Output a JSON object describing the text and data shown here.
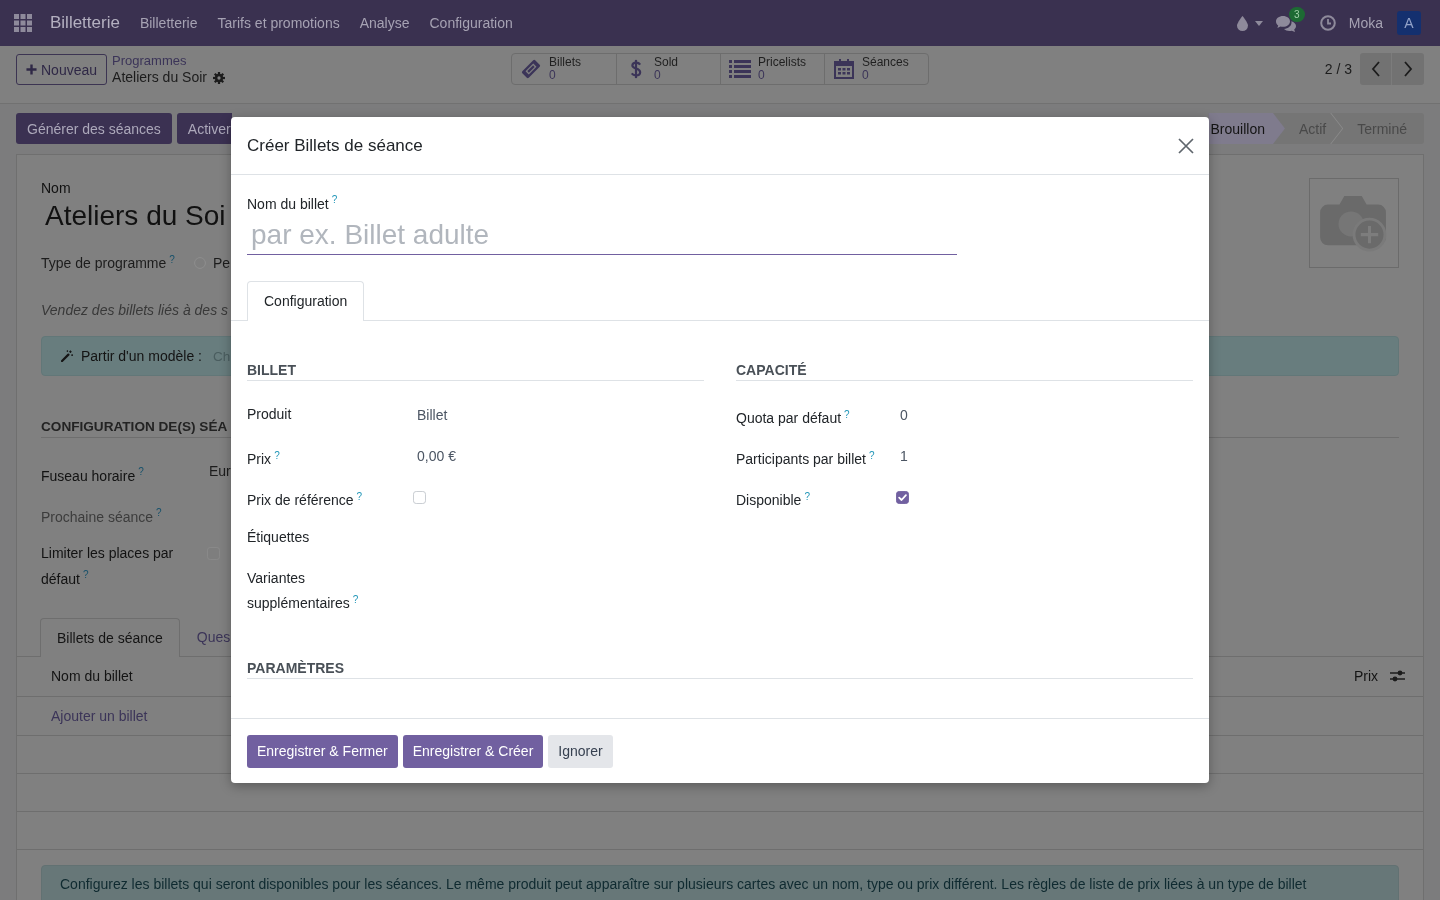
{
  "navbar": {
    "brand": "Billetterie",
    "menu": [
      {
        "label": "Billetterie"
      },
      {
        "label": "Tarifs et promotions"
      },
      {
        "label": "Analyse"
      },
      {
        "label": "Configuration"
      }
    ],
    "systray": {
      "chat_count": "3",
      "user": "Moka",
      "avatar": "A"
    }
  },
  "control_panel": {
    "new_button": "Nouveau",
    "breadcrumb": {
      "parent": "Programmes",
      "current": "Ateliers du Soir"
    },
    "stat_buttons": [
      {
        "kind": "ticket",
        "label": "Billets",
        "value": "0"
      },
      {
        "kind": "dollar",
        "label": "Sold",
        "value": "0"
      },
      {
        "kind": "list",
        "label": "Pricelists",
        "value": "0"
      },
      {
        "kind": "calendar",
        "label": "Séances",
        "value": "0"
      }
    ],
    "pager": "2 / 3"
  },
  "action_buttons": [
    {
      "label": "Générer des séances"
    },
    {
      "label": "Activer"
    }
  ],
  "status_stages": [
    {
      "label": "Brouillon",
      "selected": true
    },
    {
      "label": "Actif",
      "selected": false
    },
    {
      "label": "Terminé",
      "selected": false
    }
  ],
  "form": {
    "name_label": "Nom",
    "name": "Ateliers du Soi",
    "program_type": {
      "label": "Type de programme",
      "help": "?",
      "options": [
        {
          "label": "Pe",
          "selected": false
        }
      ]
    },
    "description": "Vendez des billets liés à des s",
    "template_banner": {
      "label": "Partir d'un modèle :",
      "placeholder": "Ch"
    },
    "section": "CONFIGURATION DE(S) SÉA",
    "fields": [
      {
        "kind": "select",
        "label": "Fuseau horaire",
        "help": "?",
        "value": "Eur"
      },
      {
        "kind": "readonly",
        "label": "Prochaine séance",
        "help": "?"
      },
      {
        "kind": "checkbox",
        "label": "Limiter les places par défaut",
        "help": "?",
        "checked": false
      }
    ],
    "tabs": [
      {
        "label": "Billets de séance",
        "selected": true
      },
      {
        "label": "Ques",
        "selected": false
      }
    ],
    "table": {
      "columns": [
        {
          "label": "Nom du billet"
        },
        {
          "label": "Prix"
        }
      ],
      "add_line": "Ajouter un billet"
    },
    "info": "Configurez les billets qui seront disponibles pour les séances. Le même produit peut apparaître sur plusieurs cartes avec un nom, type ou prix différent. Les règles de liste de prix liées à un type de billet"
  },
  "dialog": {
    "title": "Créer Billets de séance",
    "name_field": {
      "label": "Nom du billet",
      "help": "?",
      "placeholder": "par ex. Billet adulte"
    },
    "tabs": [
      {
        "label": "Configuration",
        "selected": true
      }
    ],
    "groups": [
      {
        "title": "BILLET",
        "fields": [
          {
            "kind": "text",
            "label": "Produit",
            "value": "Billet"
          },
          {
            "kind": "text",
            "label": "Prix",
            "help": "?",
            "value": "0,00 €"
          },
          {
            "kind": "checkbox",
            "label": "Prix de référence",
            "help": "?",
            "checked": false
          },
          {
            "kind": "text",
            "label": "Étiquettes"
          },
          {
            "kind": "text",
            "label": "Variantes supplémentaires",
            "help": "?"
          }
        ]
      },
      {
        "title": "CAPACITÉ",
        "fields": [
          {
            "kind": "text",
            "label": "Quota par défaut",
            "help": "?",
            "value": "0"
          },
          {
            "kind": "text",
            "label": "Participants par billet",
            "help": "?",
            "value": "1"
          },
          {
            "kind": "checkbox",
            "label": "Disponible",
            "help": "?",
            "checked": true
          }
        ]
      }
    ],
    "section": "PARAMÈTRES",
    "buttons": [
      {
        "kind": "primary",
        "label": "Enregistrer & Fermer"
      },
      {
        "kind": "primary",
        "label": "Enregistrer & Créer"
      },
      {
        "kind": "secondary",
        "label": "Ignorer"
      }
    ]
  }
}
